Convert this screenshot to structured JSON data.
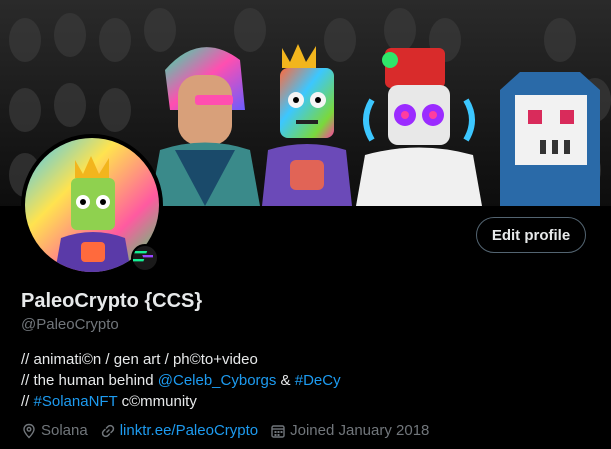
{
  "profile": {
    "display_name": "PaleoCrypto {CCS}",
    "handle": "@PaleoCrypto",
    "edit_button": "Edit profile",
    "bio": {
      "line1": "// animati©n / gen art / ph©to+video",
      "line2_prefix": "// the human behind ",
      "line2_mention": "@Celeb_Cyborgs",
      "line2_mid": " & ",
      "line2_hashtag": "#DeCy",
      "line3_prefix": "// ",
      "line3_hashtag": "#SolanaNFT",
      "line3_suffix": " c©mmunity"
    },
    "location": "Solana",
    "website": "linktr.ee/PaleoCrypto",
    "joined": "Joined January 2018"
  },
  "colors": {
    "background": "#000000",
    "text_primary": "#e7e9ea",
    "text_secondary": "#71767b",
    "link": "#1d9bf0",
    "button_border": "#536471"
  },
  "icons": {
    "location": "location-pin-icon",
    "website": "link-icon",
    "joined": "calendar-icon",
    "badge": "solana-badge-icon"
  }
}
